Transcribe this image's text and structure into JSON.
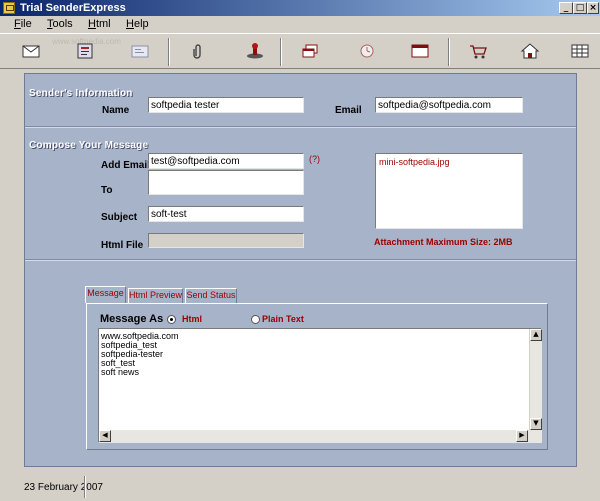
{
  "window": {
    "title": "Trial SenderExpress",
    "controls": [
      "minimize-icon",
      "maximize-icon",
      "close-icon"
    ]
  },
  "menu": [
    {
      "label_u": "F",
      "label_rest": "ile"
    },
    {
      "label_u": "T",
      "label_rest": "ools"
    },
    {
      "label_u": "H",
      "label_rest": "tml"
    },
    {
      "label_u": "H",
      "label_rest": "elp"
    }
  ],
  "toolbar": {
    "icons": [
      "envelope-icon",
      "address-book-icon",
      "card-icon",
      "paperclip-icon",
      "rubber-stamp-icon",
      "windows-icon",
      "clock-icon",
      "browser-window-icon",
      "shopping-cart-icon",
      "home-icon",
      "grid-icon"
    ],
    "watermark": "www.softpedia.com"
  },
  "sender": {
    "heading": "Sender's Information",
    "name_label": "Name",
    "name_value": "softpedia tester",
    "email_label": "Email",
    "email_value": "softpedia@softpedia.com"
  },
  "compose": {
    "heading": "Compose Your Message",
    "add_emails_label": "Add Emails",
    "add_emails_value": "test@softpedia.com",
    "help_mark": "(?)",
    "to_label": "To",
    "to_value": "",
    "subject_label": "Subject",
    "subject_value": "soft-test",
    "html_file_label": "Html File",
    "html_file_value": "",
    "attachments": [
      "mini-softpedia.jpg"
    ],
    "attachment_note": "Attachment Maximum Size: 2MB"
  },
  "tabs": {
    "items": [
      "Message",
      "Html Preview",
      "Send Status"
    ],
    "active": "Message"
  },
  "message": {
    "as_label": "Message As",
    "format_options": [
      "Html",
      "Plain Text"
    ],
    "selected_format": "Html",
    "lines": [
      "www.softpedia.com",
      "softpedia_test",
      "softpedia-tester",
      "soft_test",
      "soft news"
    ]
  },
  "status": {
    "date": "23 February 2007"
  },
  "colors": {
    "panel": "#a7b3c9",
    "accent_red": "#9a0000",
    "title_bar_start": "#0a246a"
  }
}
